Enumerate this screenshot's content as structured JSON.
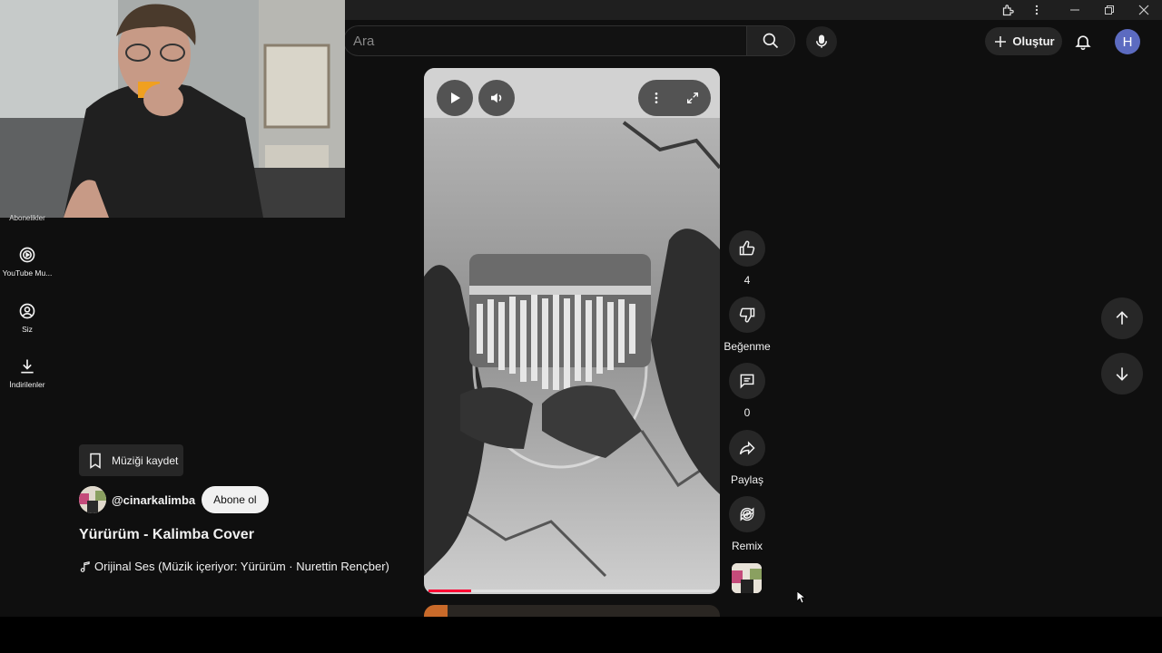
{
  "search": {
    "placeholder": "Ara"
  },
  "header": {
    "create_label": "Oluştur",
    "avatar_letter": "H"
  },
  "sidebar": {
    "clipped_label": "Abonelikler",
    "items": [
      {
        "label": "YouTube Mu...",
        "icon": "youtube-music-icon"
      },
      {
        "label": "Siz",
        "icon": "user-circle-icon"
      },
      {
        "label": "İndirilenler",
        "icon": "download-icon"
      }
    ]
  },
  "actions": {
    "like_count": "4",
    "dislike_label": "Beğenme",
    "comment_count": "0",
    "share_label": "Paylaş",
    "remix_label": "Remix"
  },
  "video": {
    "progress_fraction": 0.15
  },
  "info": {
    "save_music_label": "Müziği kaydet",
    "channel": "@cinarkalimba",
    "subscribe_label": "Abone ol",
    "title": "Yürürüm - Kalimba Cover",
    "sound": "Orijinal Ses (Müzik içeriyor: Yürürüm · Nurettin Rençber)"
  },
  "colors": {
    "accent": "#ff0033",
    "avatar": "#5c6bc0",
    "background": "#0f0f0f"
  }
}
